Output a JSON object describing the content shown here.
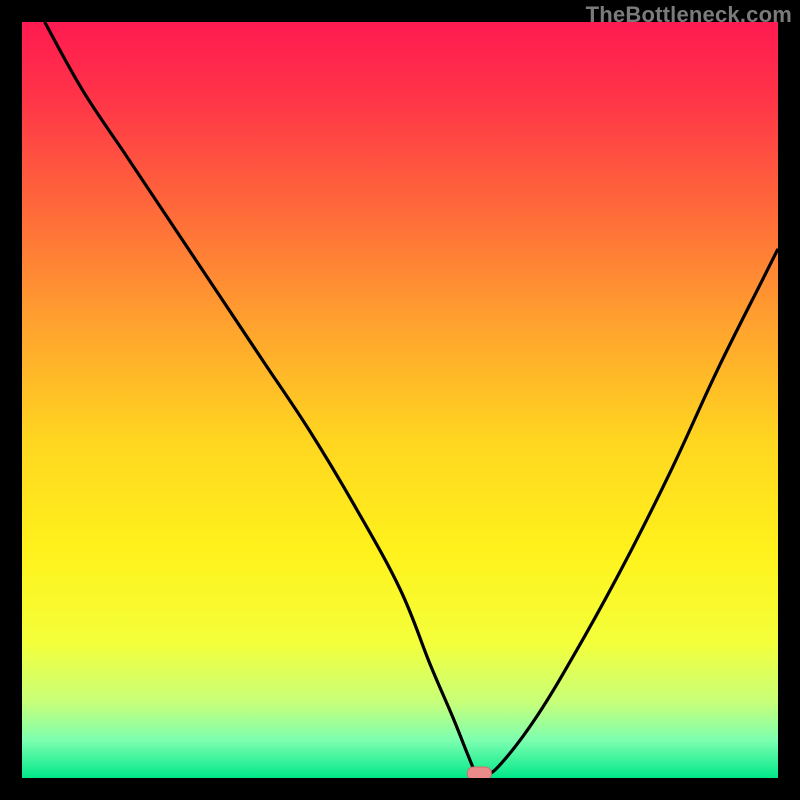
{
  "watermark": "TheBottleneck.com",
  "colors": {
    "frame": "#000000",
    "gradient_stops": [
      {
        "offset": 0.0,
        "color": "#ff1a51"
      },
      {
        "offset": 0.1,
        "color": "#ff3448"
      },
      {
        "offset": 0.25,
        "color": "#ff6a3a"
      },
      {
        "offset": 0.4,
        "color": "#ffa22e"
      },
      {
        "offset": 0.55,
        "color": "#ffd520"
      },
      {
        "offset": 0.7,
        "color": "#fff21c"
      },
      {
        "offset": 0.82,
        "color": "#f4ff3a"
      },
      {
        "offset": 0.9,
        "color": "#c7ff7a"
      },
      {
        "offset": 0.95,
        "color": "#7dffb0"
      },
      {
        "offset": 1.0,
        "color": "#00e889"
      }
    ],
    "curve": "#000000",
    "marker_fill": "#e98b8a",
    "marker_stroke": "#cf6f6d"
  },
  "chart_data": {
    "type": "line",
    "title": "",
    "xlabel": "",
    "ylabel": "",
    "xlim": [
      0,
      100
    ],
    "ylim": [
      0,
      100
    ],
    "series": [
      {
        "name": "bottleneck-curve",
        "x": [
          3,
          8,
          14,
          20,
          26,
          32,
          38,
          44,
          50,
          54,
          57,
          59,
          60,
          61,
          63,
          68,
          74,
          80,
          86,
          92,
          98,
          100
        ],
        "y": [
          100,
          91,
          82,
          73,
          64,
          55,
          46,
          36,
          25,
          15,
          8,
          3,
          0.8,
          0.5,
          1.5,
          8,
          18,
          29,
          41,
          54,
          66,
          70
        ]
      }
    ],
    "annotations": [
      {
        "name": "optimal-marker",
        "x": 60.5,
        "y": 0.6
      }
    ],
    "grid": false,
    "legend": false
  }
}
